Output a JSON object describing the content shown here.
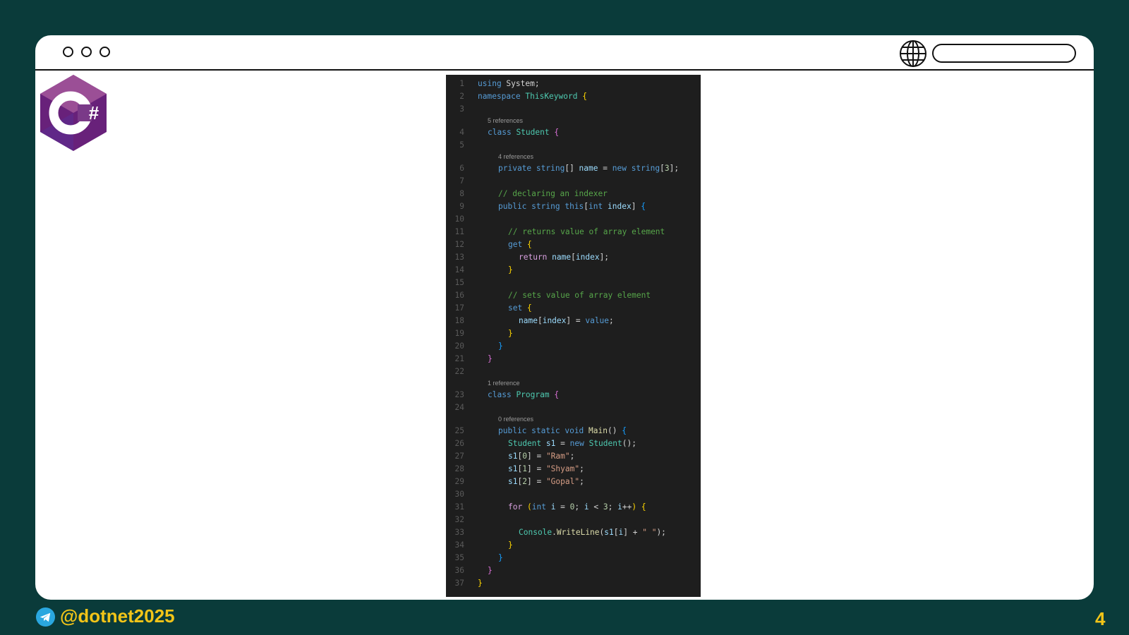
{
  "browser": {
    "url_value": "",
    "icons": [
      "window-dot-icon",
      "window-dot-icon",
      "window-dot-icon",
      "globe-icon"
    ]
  },
  "logo": {
    "text": "C#",
    "icon": "csharp-logo-icon"
  },
  "code_lines": [
    {
      "n": "1",
      "text": "using System;"
    },
    {
      "n": "2",
      "text": "namespace ThisKeyword {"
    },
    {
      "n": "3",
      "text": ""
    },
    {
      "n": "4",
      "text": "class Student {",
      "ref": "5 references"
    },
    {
      "n": "5",
      "text": ""
    },
    {
      "n": "6",
      "text": "private string[] name = new string[3];",
      "ref": "4 references"
    },
    {
      "n": "7",
      "text": ""
    },
    {
      "n": "8",
      "text": "// declaring an indexer"
    },
    {
      "n": "9",
      "text": "public string this[int index] {"
    },
    {
      "n": "10",
      "text": ""
    },
    {
      "n": "11",
      "text": "// returns value of array element"
    },
    {
      "n": "12",
      "text": "get {"
    },
    {
      "n": "13",
      "text": "return name[index];"
    },
    {
      "n": "14",
      "text": "}"
    },
    {
      "n": "15",
      "text": ""
    },
    {
      "n": "16",
      "text": "// sets value of array element"
    },
    {
      "n": "17",
      "text": "set {"
    },
    {
      "n": "18",
      "text": "name[index] = value;"
    },
    {
      "n": "19",
      "text": "}"
    },
    {
      "n": "20",
      "text": "}"
    },
    {
      "n": "21",
      "text": "}"
    },
    {
      "n": "22",
      "text": ""
    },
    {
      "n": "23",
      "text": "class Program {",
      "ref": "1 reference"
    },
    {
      "n": "24",
      "text": ""
    },
    {
      "n": "25",
      "text": "public static void Main() {",
      "ref": "0 references"
    },
    {
      "n": "26",
      "text": "Student s1 = new Student();"
    },
    {
      "n": "27",
      "text": "s1[0] = \"Ram\";"
    },
    {
      "n": "28",
      "text": "s1[1] = \"Shyam\";"
    },
    {
      "n": "29",
      "text": "s1[2] = \"Gopal\";"
    },
    {
      "n": "30",
      "text": ""
    },
    {
      "n": "31",
      "text": "for (int i = 0; i < 3; i++) {"
    },
    {
      "n": "32",
      "text": ""
    },
    {
      "n": "33",
      "text": "Console.WriteLine(s1[i] + \" \");"
    },
    {
      "n": "34",
      "text": "}"
    },
    {
      "n": "35",
      "text": "}"
    },
    {
      "n": "36",
      "text": "}"
    },
    {
      "n": "37",
      "text": "}"
    }
  ],
  "footer": {
    "handle": "@dotnet2025",
    "page_number": "4",
    "icon": "telegram-icon"
  },
  "colors": {
    "background": "#0a3b3a",
    "accent": "#f2c418",
    "editor_background": "#1e1e1e"
  }
}
